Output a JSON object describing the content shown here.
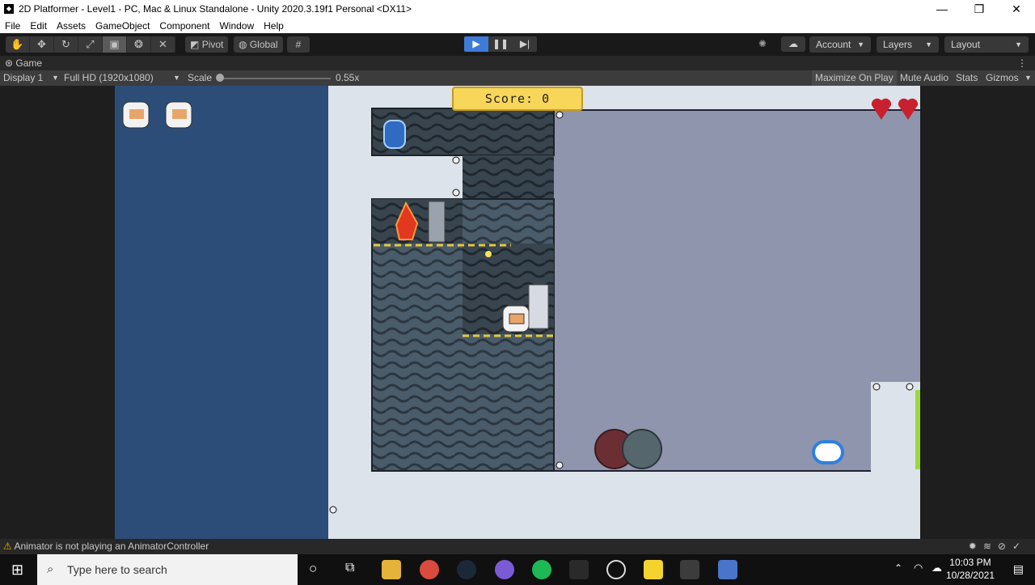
{
  "window": {
    "title": "2D Platformer - Level1 - PC, Mac & Linux Standalone - Unity 2020.3.19f1 Personal <DX11>",
    "minimize": "—",
    "restore": "❐",
    "close": "✕"
  },
  "menu": [
    "File",
    "Edit",
    "Assets",
    "GameObject",
    "Component",
    "Window",
    "Help"
  ],
  "toolbar": {
    "pivot": "Pivot",
    "global": "Global",
    "account": "Account",
    "layers": "Layers",
    "layout": "Layout"
  },
  "game_tab": {
    "label": "Game"
  },
  "game_controls": {
    "display": "Display 1",
    "resolution": "Full HD (1920x1080)",
    "scale_label": "Scale",
    "scale_value": "0.55x",
    "maximize_on_play": "Maximize On Play",
    "mute_audio": "Mute Audio",
    "stats": "Stats",
    "gizmos": "Gizmos"
  },
  "game": {
    "score_text": "Score: 0",
    "lives_remaining": 2,
    "hearts": 2
  },
  "status": {
    "message": "Animator is not playing an AnimatorController"
  },
  "taskbar": {
    "search_placeholder": "Type here to search",
    "time": "10:03 PM",
    "date": "10/28/2021"
  },
  "colors": {
    "game_bg": "#2b4d78",
    "play_active": "#3d7bd6",
    "score_bg": "#f7d65a",
    "heart": "#c8202e"
  }
}
